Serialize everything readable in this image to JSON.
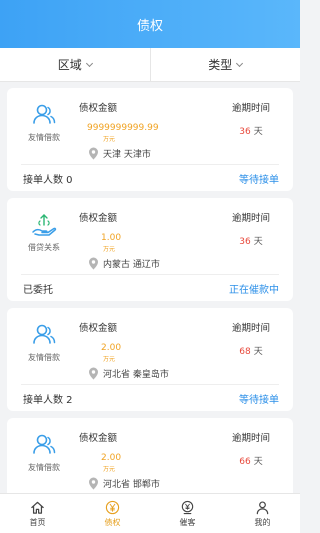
{
  "header": {
    "title": "债权"
  },
  "filters": [
    {
      "label": "区域"
    },
    {
      "label": "类型"
    }
  ],
  "labels": {
    "amount": "债权金额",
    "overdue": "逾期时间",
    "unit": "万元",
    "day_unit": "天"
  },
  "cards": [
    {
      "type": "友情借款",
      "icon": "friends-icon",
      "amount": "9999999999.99",
      "location": "天津 天津市",
      "days": "36",
      "footer_left": "接单人数 0",
      "footer_right": "等待接单"
    },
    {
      "type": "借贷关系",
      "icon": "loan-icon",
      "amount": "1.00",
      "location": "内蒙古 通辽市",
      "days": "36",
      "footer_left": "已委托",
      "footer_right": "正在催款中"
    },
    {
      "type": "友情借款",
      "icon": "friends-icon",
      "amount": "2.00",
      "location": "河北省 秦皇岛市",
      "days": "68",
      "footer_left": "接单人数 2",
      "footer_right": "等待接单"
    },
    {
      "type": "友情借款",
      "icon": "friends-icon",
      "amount": "2.00",
      "location": "河北省 邯郸市",
      "days": "66",
      "footer_left": "",
      "footer_right": ""
    }
  ],
  "tabs": [
    {
      "label": "首页",
      "icon": "home-icon",
      "active": false
    },
    {
      "label": "债权",
      "icon": "yen-coin-icon",
      "active": true
    },
    {
      "label": "催客",
      "icon": "yen-badge-icon",
      "active": false
    },
    {
      "label": "我的",
      "icon": "person-icon",
      "active": false
    }
  ],
  "colors": {
    "header": "#3da2f5",
    "amount": "#f0a323",
    "days": "#e8493c",
    "status": "#2b8fe8",
    "active_tab": "#e6a020"
  }
}
